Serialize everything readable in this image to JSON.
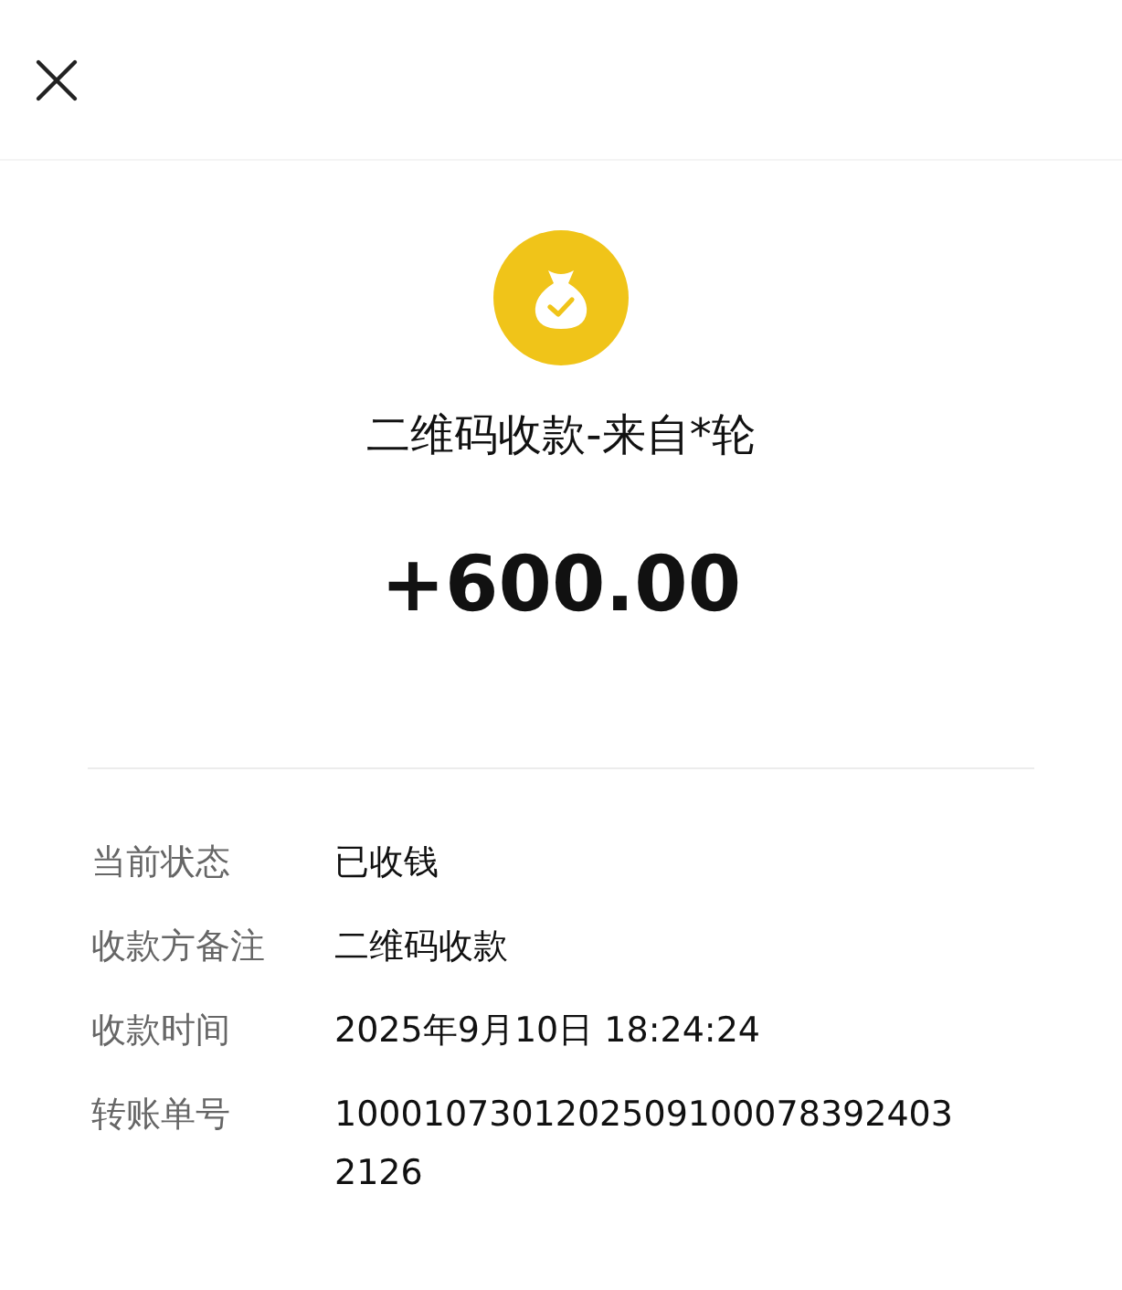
{
  "title": "二维码收款-来自*轮",
  "amount": "+600.00",
  "details": [
    {
      "label": "当前状态",
      "value": "已收钱"
    },
    {
      "label": "收款方备注",
      "value": "二维码收款"
    },
    {
      "label": "收款时间",
      "value": "2025年9月10日 18:24:24"
    },
    {
      "label": "转账单号",
      "value": "10001073012025091000783924032126"
    }
  ]
}
